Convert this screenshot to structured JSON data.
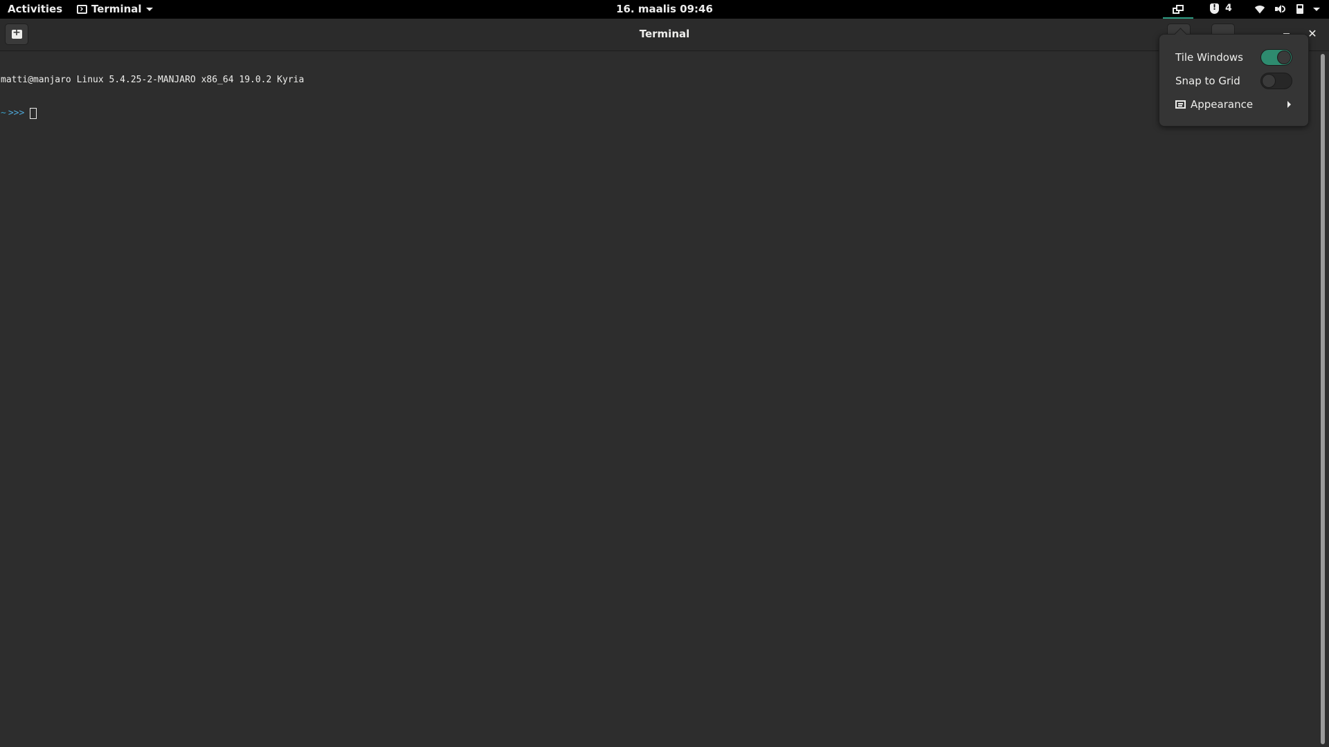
{
  "topbar": {
    "activities_label": "Activities",
    "app_menu_label": "Terminal",
    "clock": "16. maalis 09:46",
    "notification_count": "4"
  },
  "icons": {
    "app_menu": "terminal-icon",
    "tiling": "tile-windows-icon",
    "notifications": "shield-icon",
    "network": "wifi-icon",
    "volume": "speaker-icon",
    "power": "battery-icon",
    "new_tab": "new-tab-icon",
    "appearance": "appearance-icon"
  },
  "window": {
    "title": "Terminal"
  },
  "terminal": {
    "line1": "matti@manjaro Linux 5.4.25-2-MANJARO x86_64 19.0.2 Kyria",
    "prompt_dir": "~",
    "prompt_arrows": ">>>"
  },
  "tiling_menu": {
    "tile_windows_label": "Tile Windows",
    "tile_windows_on": true,
    "snap_to_grid_label": "Snap to Grid",
    "snap_to_grid_on": false,
    "appearance_label": "Appearance"
  },
  "colors": {
    "accent": "#2e9e84",
    "prompt": "#4ea6d6",
    "background": "#2d2d2d"
  }
}
